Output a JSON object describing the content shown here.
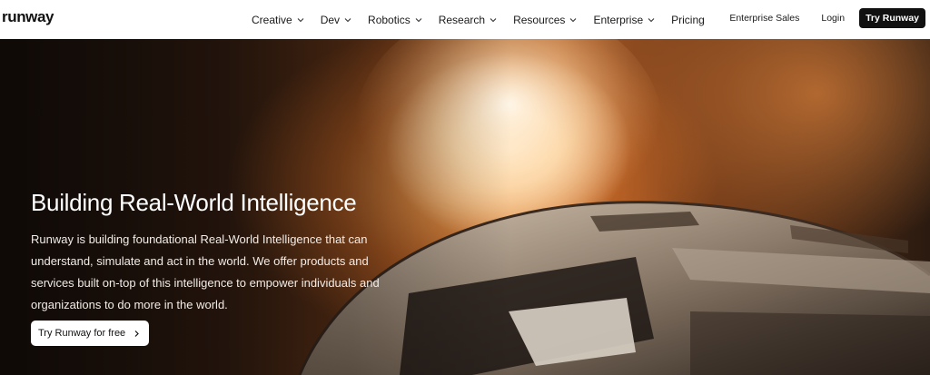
{
  "brand": {
    "name": "runway"
  },
  "nav": {
    "menu": [
      {
        "label": "Creative",
        "has_dropdown": true
      },
      {
        "label": "Dev",
        "has_dropdown": true
      },
      {
        "label": "Robotics",
        "has_dropdown": true
      },
      {
        "label": "Research",
        "has_dropdown": true
      },
      {
        "label": "Resources",
        "has_dropdown": true
      },
      {
        "label": "Enterprise",
        "has_dropdown": true
      },
      {
        "label": "Pricing",
        "has_dropdown": false
      }
    ],
    "enterprise_sales": "Enterprise Sales",
    "login": "Login",
    "try_runway": "Try Runway"
  },
  "hero": {
    "title": "Building Real-World Intelligence",
    "description": "Runway is building foundational Real-World Intelligence that can understand, simulate and act in the world. We offer products and services built on-top of this intelligence to empower individuals and organizations to do more in the world.",
    "cta_label": "Try Runway for free"
  },
  "colors": {
    "cta_bg": "#ffffff",
    "nav_button_bg": "#111111",
    "hero_glow": "#f0a060"
  },
  "icons": {
    "dropdown": "chevron-down-icon",
    "cta_arrow": "chevron-right-icon"
  }
}
